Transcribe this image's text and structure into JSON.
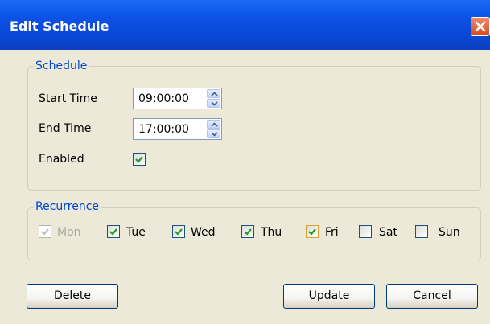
{
  "window": {
    "title": "Edit Schedule"
  },
  "schedule_group": {
    "legend": "Schedule",
    "start_time_label": "Start Time",
    "start_time_value": "09:00:00",
    "end_time_label": "End Time",
    "end_time_value": "17:00:00",
    "enabled_label": "Enabled",
    "enabled_checked": true
  },
  "recurrence_group": {
    "legend": "Recurrence",
    "days": [
      {
        "label": "Mon",
        "checked": true,
        "enabled": false
      },
      {
        "label": "Tue",
        "checked": true,
        "enabled": true
      },
      {
        "label": "Wed",
        "checked": true,
        "enabled": true
      },
      {
        "label": "Thu",
        "checked": true,
        "enabled": true
      },
      {
        "label": "Fri",
        "checked": true,
        "enabled": true
      },
      {
        "label": "Sat",
        "checked": false,
        "enabled": true
      },
      {
        "label": "Sun",
        "checked": false,
        "enabled": true
      }
    ]
  },
  "buttons": {
    "delete_label": "Delete",
    "update_label": "Update",
    "cancel_label": "Cancel"
  },
  "colors": {
    "titlebar": "#0c52e6",
    "legend_text": "#0046d5",
    "checkmark": "#21a121",
    "close_button": "#d9481f"
  }
}
